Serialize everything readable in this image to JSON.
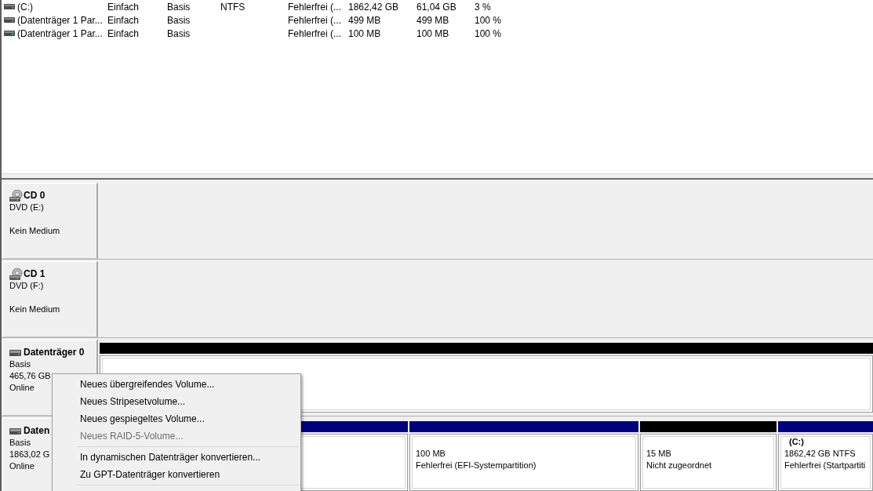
{
  "volume_list": {
    "rows": [
      {
        "column_1": "(C:)",
        "column_2": "Einfach",
        "column_3": "Basis",
        "column_4": "NTFS",
        "column_5": "Fehlerfrei (...",
        "column_6": "1862,42 GB",
        "column_7": "61,04 GB",
        "column_8": "3 %"
      },
      {
        "column_1": "(Datenträger 1 Par...",
        "column_2": "Einfach",
        "column_3": "Basis",
        "column_5": "Fehlerfrei (...",
        "column_6": "499 MB",
        "column_7": "499 MB",
        "column_8": "100 %"
      },
      {
        "column_1": "(Datenträger 1 Par...",
        "column_2": "Einfach",
        "column_3": "Basis",
        "column_5": "Fehlerfrei (...",
        "column_6": "100 MB",
        "column_7": "100 MB",
        "column_8": "100 %"
      }
    ]
  },
  "disks": [
    {
      "kind": "cd",
      "name": "CD 0",
      "type": "DVD (E:)",
      "status": "Kein Medium"
    },
    {
      "kind": "cd",
      "name": "CD 1",
      "type": "DVD (F:)",
      "status": "Kein Medium"
    },
    {
      "kind": "disk",
      "name": "Datenträger 0",
      "type": "Basis",
      "size": "465,76 GB",
      "status": "Online",
      "partitions": [
        {
          "kind": "unallocated"
        }
      ]
    },
    {
      "kind": "disk",
      "name": "Daten",
      "type": "Basis",
      "size": "1863,02 G",
      "status": "Online",
      "partitions": [
        {
          "kind": "primary"
        },
        {
          "kind": "primary",
          "size": "100 MB",
          "status": "Fehlerfrei (EFI-Systempartition)"
        },
        {
          "kind": "unallocated",
          "size": "15 MB",
          "status": "Nicht zugeordnet"
        },
        {
          "kind": "primary",
          "name": "(C:)",
          "size": "1862,42 GB NTFS",
          "status": "Fehlerfrei (Startpartiti"
        }
      ]
    }
  ],
  "context_menu": {
    "items": [
      {
        "kind": "item",
        "label": "Neues übergreifendes Volume...",
        "disabled": false
      },
      {
        "kind": "item",
        "label": "Neues Stripesetvolume...",
        "disabled": false
      },
      {
        "kind": "item",
        "label": "Neues gespiegeltes Volume...",
        "disabled": false
      },
      {
        "kind": "item",
        "label": "Neues RAID-5-Volume...",
        "disabled": true
      },
      {
        "kind": "separator"
      },
      {
        "kind": "item",
        "label": "In dynamischen Datenträger konvertieren...",
        "disabled": false
      },
      {
        "kind": "item",
        "label": "Zu GPT-Datenträger konvertieren",
        "disabled": false
      },
      {
        "kind": "separator"
      }
    ]
  }
}
